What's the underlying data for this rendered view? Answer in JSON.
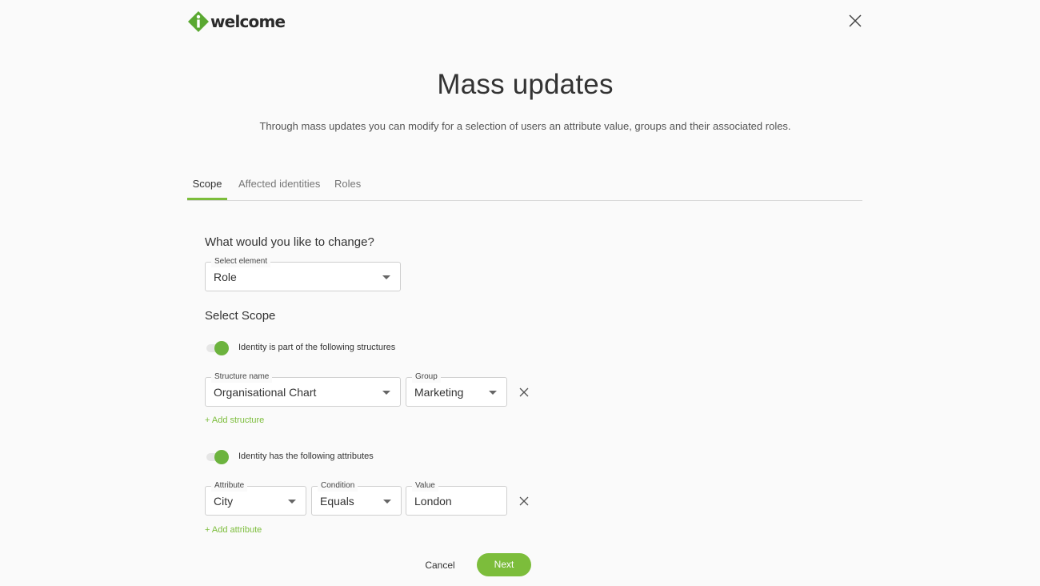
{
  "brand": {
    "name": "welcome",
    "logo_color": "#5aa831"
  },
  "header": {
    "title": "Mass updates",
    "subtitle": "Through mass updates you can modify for a selection of users an attribute value, groups and their associated roles."
  },
  "tabs": [
    {
      "label": "Scope",
      "active": true
    },
    {
      "label": "Affected identities",
      "active": false
    },
    {
      "label": "Roles",
      "active": false
    }
  ],
  "change": {
    "question": "What would you like to change?",
    "element_label": "Select element",
    "element_value": "Role"
  },
  "scope": {
    "title": "Select Scope",
    "structures_toggle": {
      "label": "Identity is part of the following structures",
      "on": true
    },
    "structure": {
      "name_label": "Structure name",
      "name_value": "Organisational Chart",
      "group_label": "Group",
      "group_value": "Marketing"
    },
    "add_structure": "+ Add structure",
    "attributes_toggle": {
      "label": "Identity has the following attributes",
      "on": true
    },
    "attribute": {
      "attr_label": "Attribute",
      "attr_value": "City",
      "cond_label": "Condition",
      "cond_value": "Equals",
      "value_label": "Value",
      "value_value": "London"
    },
    "add_attribute": "+ Add attribute"
  },
  "footer": {
    "cancel": "Cancel",
    "next": "Next"
  },
  "colors": {
    "accent": "#7cbd3b",
    "toggle": "#6cb33e"
  },
  "icons": {
    "close": "close-icon",
    "caret": "chevron-down-icon",
    "remove": "remove-icon"
  }
}
